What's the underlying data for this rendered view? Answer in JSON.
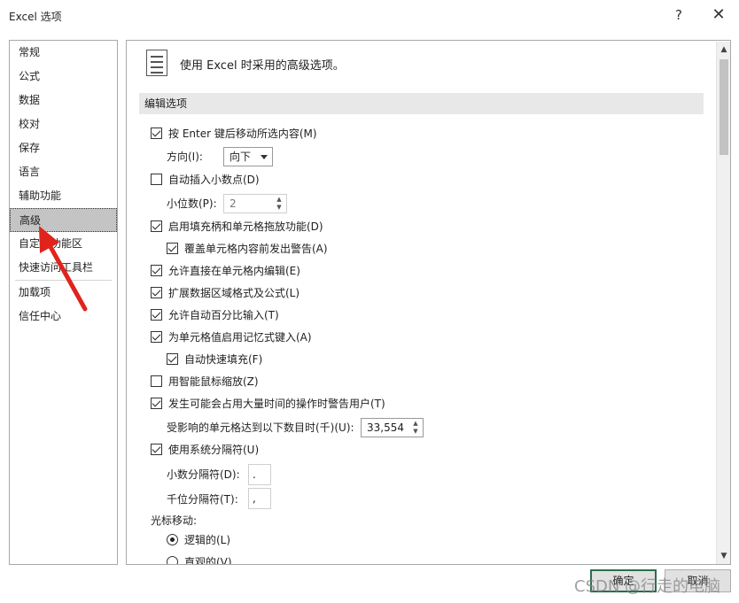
{
  "window": {
    "title": "Excel 选项",
    "help_glyph": "?",
    "close_glyph": "✕"
  },
  "sidebar": {
    "items": [
      {
        "label": "常规"
      },
      {
        "label": "公式"
      },
      {
        "label": "数据"
      },
      {
        "label": "校对"
      },
      {
        "label": "保存"
      },
      {
        "label": "语言"
      },
      {
        "label": "辅助功能"
      },
      {
        "label": "高级",
        "selected": true
      },
      {
        "label": "自定义功能区"
      },
      {
        "label": "快速访问工具栏"
      },
      {
        "label": "加载项"
      },
      {
        "label": "信任中心"
      }
    ]
  },
  "content": {
    "header": {
      "icon": "advanced-options-icon",
      "text": "使用 Excel 时采用的高级选项。"
    },
    "section_title": "编辑选项",
    "options": {
      "move_after_enter": {
        "label": "按 Enter 键后移动所选内容(M)",
        "checked": true
      },
      "direction": {
        "label": "方向(I):",
        "value": "向下"
      },
      "auto_decimal": {
        "label": "自动插入小数点(D)",
        "checked": false
      },
      "places": {
        "label": "小位数(P):",
        "value": "2"
      },
      "fill_handle": {
        "label": "启用填充柄和单元格拖放功能(D)",
        "checked": true
      },
      "alert_overwrite": {
        "label": "覆盖单元格内容前发出警告(A)",
        "checked": true
      },
      "edit_in_cell": {
        "label": "允许直接在单元格内编辑(E)",
        "checked": true
      },
      "extend_formats": {
        "label": "扩展数据区域格式及公式(L)",
        "checked": true
      },
      "auto_percent": {
        "label": "允许自动百分比输入(T)",
        "checked": true
      },
      "autocomplete": {
        "label": "为单元格值启用记忆式键入(A)",
        "checked": true
      },
      "flash_fill": {
        "label": "自动快速填充(F)",
        "checked": true
      },
      "intellimouse_zoom": {
        "label": "用智能鼠标缩放(Z)",
        "checked": false
      },
      "alert_slow": {
        "label": "发生可能会占用大量时间的操作时警告用户(T)",
        "checked": true
      },
      "cells_threshold": {
        "label": "受影响的单元格达到以下数目时(千)(U):",
        "value": "33,554"
      },
      "system_separators": {
        "label": "使用系统分隔符(U)",
        "checked": true
      },
      "decimal_sep": {
        "label": "小数分隔符(D):",
        "value": "."
      },
      "thousands_sep": {
        "label": "千位分隔符(T):",
        "value": ","
      },
      "cursor_movement": {
        "label": "光标移动:"
      },
      "logical": {
        "label": "逻辑的(L)",
        "checked": true
      },
      "visual": {
        "label": "直观的(V)",
        "checked": false
      }
    }
  },
  "footer": {
    "ok_label": "确定",
    "cancel_label": "取消"
  },
  "watermark": "CSDN @行走的电脑",
  "colors": {
    "annotation_arrow": "#e0241c",
    "selected_item_bg": "#c4c4c4",
    "section_bar_bg": "#e8e8e8"
  }
}
